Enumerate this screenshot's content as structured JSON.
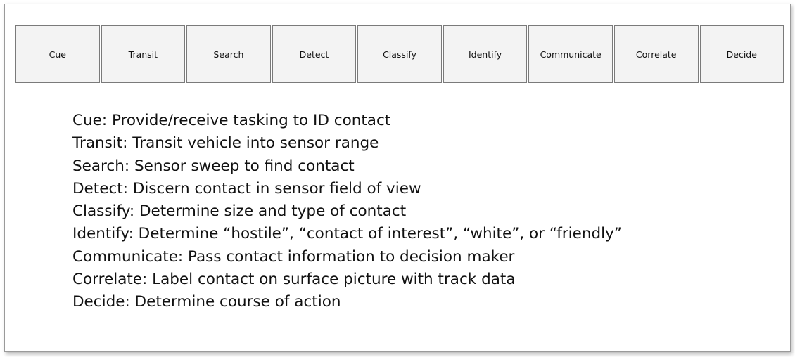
{
  "steps": [
    "Cue",
    "Transit",
    "Search",
    "Detect",
    "Classify",
    "Identify",
    "Communicate",
    "Correlate",
    "Decide"
  ],
  "descriptions": [
    "Cue: Provide/receive tasking to ID contact",
    "Transit: Transit vehicle into sensor range",
    "Search: Sensor sweep to find contact",
    "Detect: Discern contact in sensor field of view",
    "Classify: Determine size and type of contact",
    "Identify: Determine “hostile”, “contact of interest”, “white”, or  “friendly”",
    "Communicate: Pass contact information to decision maker",
    "Correlate: Label contact on surface picture with track data",
    "Decide: Determine course of action"
  ]
}
